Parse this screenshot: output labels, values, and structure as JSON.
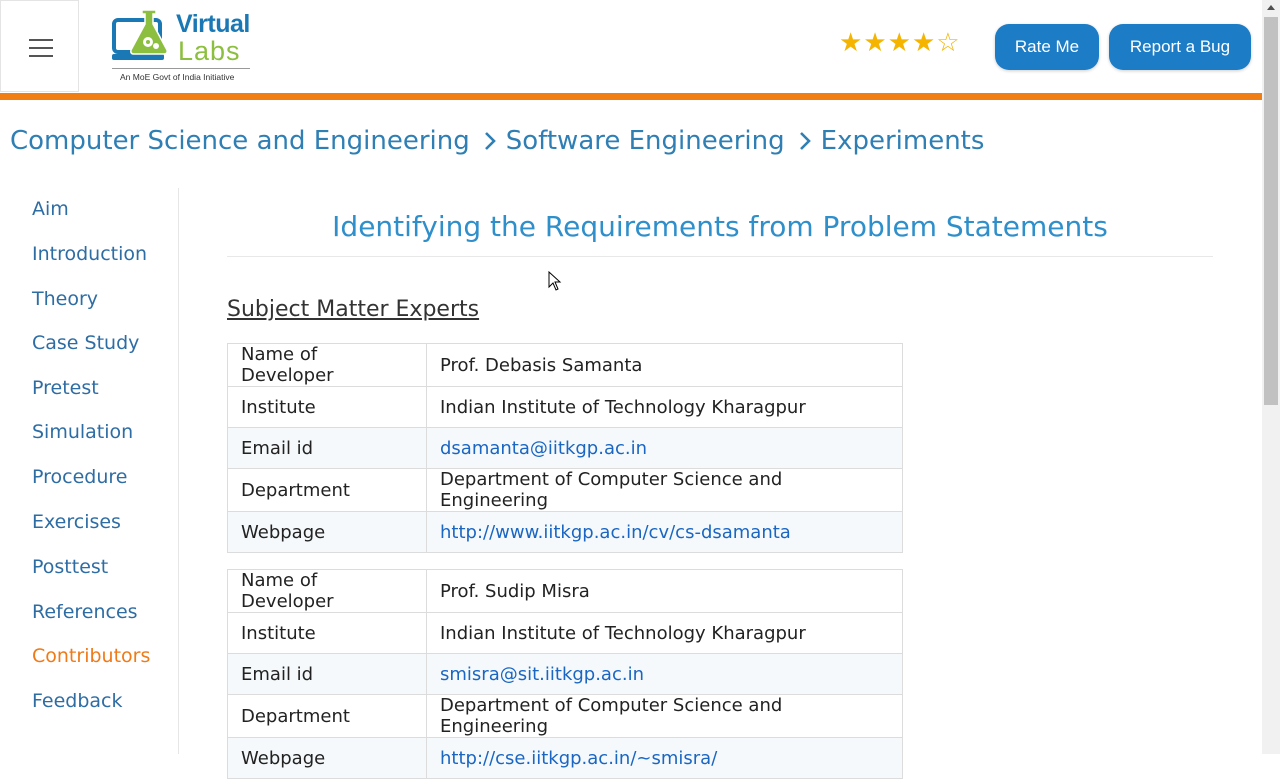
{
  "header": {
    "logo_title": "Virtual",
    "logo_sub_title": "Labs",
    "logo_tagline": "An MoE Govt of India Initiative",
    "rating": {
      "value": 4,
      "max": 5
    },
    "rate_label": "Rate Me",
    "bug_label": "Report a Bug"
  },
  "breadcrumb": [
    "Computer Science and Engineering",
    "Software Engineering",
    "Experiments"
  ],
  "sidebar": {
    "items": [
      {
        "label": "Aim"
      },
      {
        "label": "Introduction"
      },
      {
        "label": "Theory"
      },
      {
        "label": "Case Study"
      },
      {
        "label": "Pretest"
      },
      {
        "label": "Simulation"
      },
      {
        "label": "Procedure"
      },
      {
        "label": "Exercises"
      },
      {
        "label": "Posttest"
      },
      {
        "label": "References"
      },
      {
        "label": "Contributors",
        "active": true
      },
      {
        "label": "Feedback"
      }
    ]
  },
  "main": {
    "title": "Identifying the Requirements from Problem Statements",
    "section": "Subject Matter Experts",
    "experts": [
      {
        "rows": [
          {
            "label": "Name of Developer",
            "value": "Prof. Debasis Samanta"
          },
          {
            "label": "Institute",
            "value": "Indian Institute of Technology Kharagpur"
          },
          {
            "label": "Email id",
            "value": "dsamanta@iitkgp.ac.in",
            "link": true
          },
          {
            "label": "Department",
            "value": "Department of Computer Science and Engineering"
          },
          {
            "label": "Webpage",
            "value": "http://www.iitkgp.ac.in/cv/cs-dsamanta",
            "link": true
          }
        ]
      },
      {
        "rows": [
          {
            "label": "Name of Developer",
            "value": "Prof. Sudip Misra"
          },
          {
            "label": "Institute",
            "value": "Indian Institute of Technology Kharagpur"
          },
          {
            "label": "Email id",
            "value": "smisra@sit.iitkgp.ac.in",
            "link": true
          },
          {
            "label": "Department",
            "value": "Department of Computer Science and Engineering"
          },
          {
            "label": "Webpage",
            "value": "http://cse.iitkgp.ac.in/~smisra/",
            "link": true
          }
        ]
      }
    ]
  },
  "colors": {
    "accent_blue": "#1c7cc6",
    "orange": "#f07e14",
    "link": "#2e6da4",
    "active": "#ef7a18"
  }
}
